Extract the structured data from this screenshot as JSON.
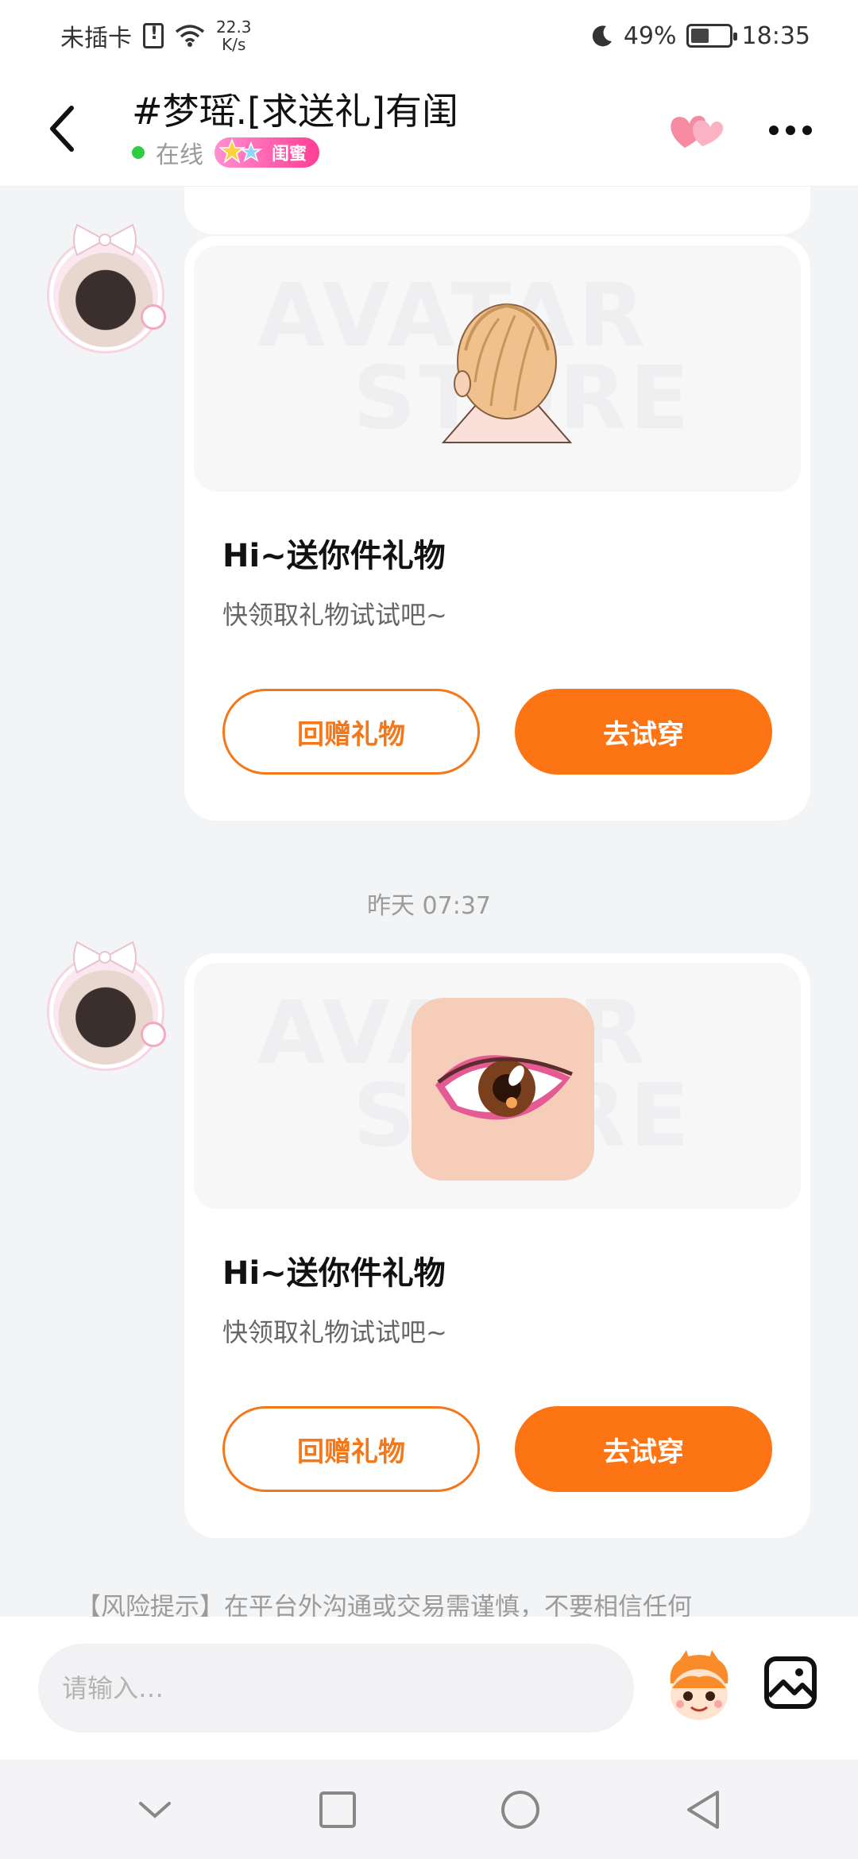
{
  "status_bar": {
    "carrier": "未插卡",
    "net_speed_value": "22.3",
    "net_speed_unit": "K/s",
    "battery": "49%",
    "battery_level": 0.49,
    "time": "18:35"
  },
  "header": {
    "title": "#梦瑶.̀[求送礼]有闺",
    "online_status": "在线",
    "relation_badge": "闺蜜"
  },
  "messages": [
    {
      "type": "gift_card",
      "item_icon": "hair-item-icon",
      "watermark_line1": "AVATAR",
      "watermark_line2": "STORE",
      "title": "Hi~送你件礼物",
      "subtitle": "快领取礼物试试吧~",
      "secondary_button": "回赠礼物",
      "primary_button": "去试穿"
    },
    {
      "type": "gift_card",
      "item_icon": "eye-item-icon",
      "watermark_line1": "AVATAR",
      "watermark_line2": "STORE",
      "title": "Hi~送你件礼物",
      "subtitle": "快领取礼物试试吧~",
      "secondary_button": "回赠礼物",
      "primary_button": "去试穿"
    }
  ],
  "timestamp": "昨天 07:37",
  "risk_notice": "【风险提示】在平台外沟通或交易需谨慎，不要相信任何",
  "input": {
    "placeholder": "请输入…"
  },
  "colors": {
    "accent": "#fd7415",
    "online": "#2ecc40",
    "badge": "#ff3e96"
  }
}
